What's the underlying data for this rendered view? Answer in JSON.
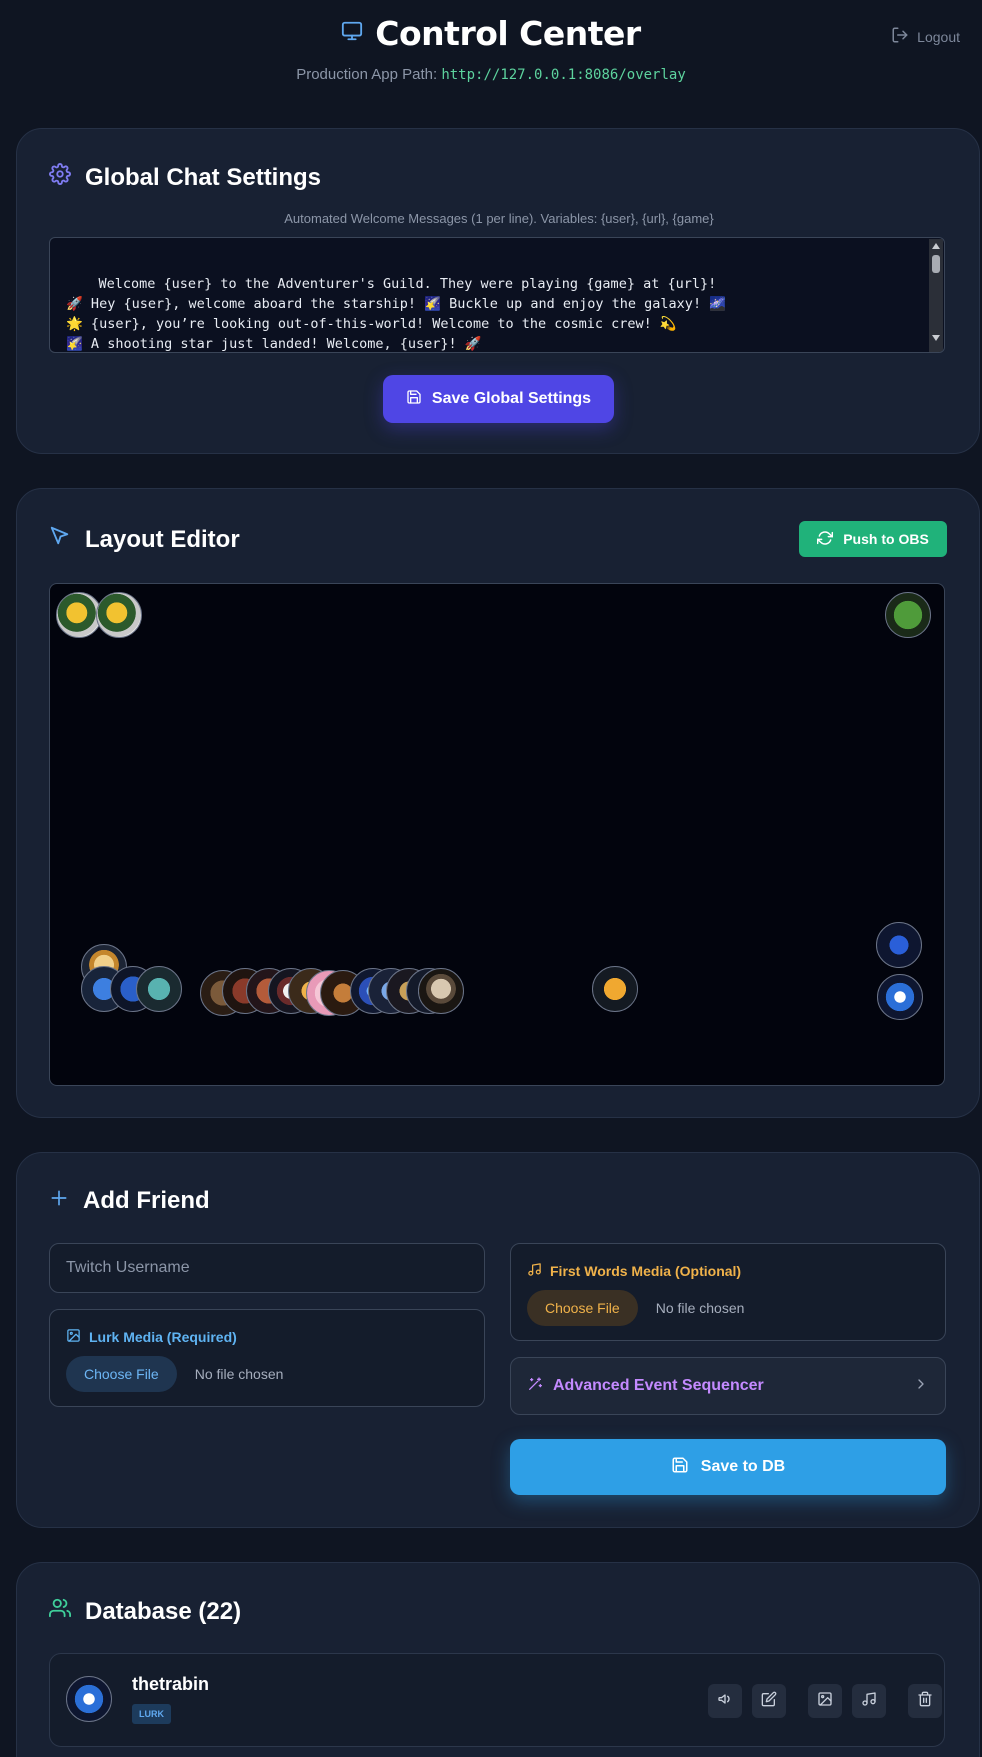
{
  "header": {
    "title": "Control Center",
    "path_label": "Production App Path: ",
    "path_value": "http://127.0.0.1:8086/overlay",
    "logout_label": "Logout"
  },
  "global_chat": {
    "title": "Global Chat Settings",
    "hint": "Automated Welcome Messages (1 per line). Variables: {user}, {url}, {game}",
    "messages": "Welcome {user} to the Adventurer's Guild. They were playing {game} at {url}!\n🚀 Hey {user}, welcome aboard the starship! 🌠 Buckle up and enjoy the galaxy! 🌌\n🌟 {user}, you’re looking out-of-this-world! Welcome to the cosmic crew! 💫\n🌠 A shooting star just landed! Welcome, {user}! 🚀\n👽 {user}! Alien greetings from the intergalactic team! 🌌",
    "save_label": "Save Global Settings"
  },
  "layout_editor": {
    "title": "Layout Editor",
    "push_label": "Push to OBS"
  },
  "add_friend": {
    "title": "Add Friend",
    "username_placeholder": "Twitch Username",
    "lurk_label": "Lurk Media (Required)",
    "first_words_label": "First Words Media (Optional)",
    "choose_file": "Choose File",
    "no_file": "No file chosen",
    "sequencer_label": "Advanced Event Sequencer",
    "save_label": "Save to DB"
  },
  "database": {
    "title": "Database (22)",
    "entries": [
      {
        "username": "thetrabin",
        "badge": "LURK"
      }
    ]
  },
  "colors": {
    "background": "#0f1522",
    "card": "#182133",
    "primary_button": "#4f46e5",
    "push_button": "#20b27a",
    "save_db_button": "#2e9fe6",
    "path_text": "#5dd39e",
    "first_words_accent": "#f0b24a",
    "lurk_accent": "#5fb3f2",
    "sequencer_accent": "#c48aff"
  }
}
